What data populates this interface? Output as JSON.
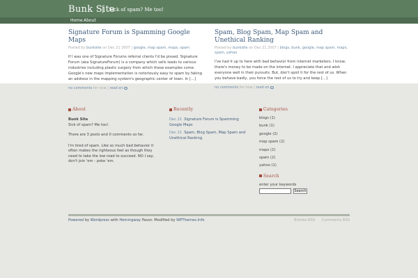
{
  "header": {
    "site_title": "Bunk Site",
    "tagline": "Sick of spam? Me too!"
  },
  "nav": {
    "items": [
      "Home",
      "About"
    ]
  },
  "posts": [
    {
      "title": "Signature Forum is Spamming Google Maps",
      "meta_prefix": "Posted by",
      "author": "bunksite",
      "date_prefix": "on Dec 21 2007",
      "tags": "google, map spam, maps, spam",
      "body": "If I was one of Signature Forums referral clients I'd be pissed. Signature Forum (aka SignatureForum) is a company which sells leads to various industries including plastic surgery from which these examples come. Google's new maps implementation is notoriously easy to spam by faking an address in the mapping system's geographic center of town. In [...]",
      "comments": "no comments",
      "comments_for": "for now",
      "read_on": "read on"
    },
    {
      "title": "Spam, Blog Spam, Map Spam and Unethical Ranking",
      "meta_prefix": "Posted by",
      "author": "bunksite",
      "date_prefix": "on Dec 21 2007",
      "tags": "blogs, bunk, google, map spam, maps, spam, yahoo",
      "body": "I've had it up to here with bad behavior from internet marketers. I know, there's money to be made on the internet. I appreciate that and wish everyone well in their pursuits. But, don't spoil it for the rest of us. When you behave badly, you force the rest of us to try and keep [...]",
      "comments": "no comments",
      "comments_for": "for now",
      "read_on": "read on"
    }
  ],
  "about": {
    "heading": "About",
    "name": "Bunk Site",
    "tagline": "Sick of spam? Me too!.",
    "stats": "There are 3 posts and 0 comments so far.",
    "text": "I'm tired of spam.  Like so much bad behavior it often makes the righteous feel as though they need to take the low road to succeed. NO I say, don't join 'em - poke 'em."
  },
  "recently": {
    "heading": "Recently",
    "items": [
      {
        "date": "Dec 21",
        "title": "Signature Forum is Spamming Google Maps"
      },
      {
        "date": "Dec 21",
        "title": "Spam, Blog Spam, Map Spam and Unethical Ranking"
      }
    ]
  },
  "categories": {
    "heading": "Categories",
    "items": [
      "blogs (1)",
      "bunk (1)",
      "google (2)",
      "map spam (2)",
      "maps (2)",
      "spam (2)",
      "yahoo (1)"
    ]
  },
  "search": {
    "heading": "Search",
    "label": "enter your keywords",
    "button": "Search",
    "value": ""
  },
  "footer": {
    "powered": "Powered",
    "by1": "by",
    "wordpress": "Wordpress",
    "with": "with",
    "hemingway": "Hemingway",
    "flavor": "flavor. Modified by",
    "wpthemes": "WPThemes.Info",
    "entries_rss": "Entries RSS",
    "comments_rss": "Comments RSS"
  }
}
